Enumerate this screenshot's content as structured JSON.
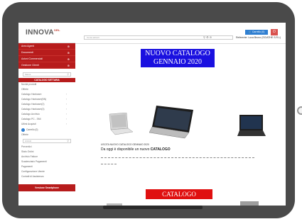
{
  "header": {
    "logo_text": "INNOVA",
    "logo_sup": "SRL",
    "search_placeholder": "Cerca articoli",
    "user_info": "Referente: Luca Bruno (SCIATHE S.R.L)",
    "cart_label": "Carrello (0)",
    "power_icon": "power-icon"
  },
  "sidebar": {
    "red_items": [
      {
        "label": "Area Agenti"
      },
      {
        "label": "Documenti"
      },
      {
        "label": "Azioni Commerciali"
      },
      {
        "label": "Gestione Clienti"
      }
    ],
    "search1_placeholder": "Marca",
    "catalog_heading": "CATALOGO SETTARIA",
    "catalog_links": [
      {
        "label": "Novità prodotti",
        "has_arrow": false
      },
      {
        "label": "Offerte",
        "has_arrow": false
      },
      {
        "label": "Catalogo Hardware",
        "has_arrow": true
      },
      {
        "label": "Catalogo Hardware(BN)",
        "has_arrow": true
      },
      {
        "label": "Catalogo Hardware(2)",
        "has_arrow": true
      },
      {
        "label": "Catalogo Hardware(3)",
        "has_arrow": true
      },
      {
        "label": "Catalogo Archivio",
        "has_arrow": true
      },
      {
        "label": "Catalogo PC - SMI",
        "has_arrow": true
      },
      {
        "label": "Ultimi Acquisti",
        "has_arrow": true
      }
    ],
    "cart_row_label": "Carrello (0)",
    "offer_label": "Offerte",
    "search2_placeholder": "Articoli",
    "other_links": [
      {
        "label": "Preventivi"
      },
      {
        "label": "Stato Ordini"
      },
      {
        "label": "Archivio Fatture"
      },
      {
        "label": "Scadenziario Pagamenti"
      },
      {
        "label": "Pagamenti"
      },
      {
        "label": "Configurazione Utente"
      },
      {
        "label": "Contatti di Assistenza"
      }
    ],
    "footer_label": "Versione Smartphone"
  },
  "main": {
    "banner_line1": "NUOVO CATALOGO",
    "banner_line2": "GENNAIO 2020",
    "announce_small": "USCITA NUOVO CATALOGO GENNAIO 2020",
    "announce_large_prefix": "Da oggi è disponibile un nuovo ",
    "announce_large_strong": "CATALOGO",
    "banner2": "CATALOGO STAMPANTI"
  }
}
